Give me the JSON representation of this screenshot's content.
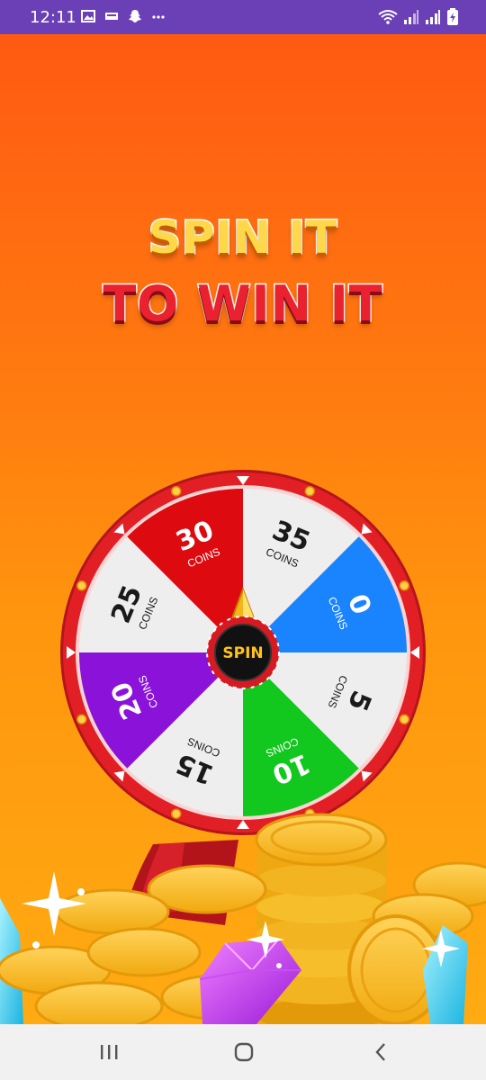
{
  "status_bar": {
    "time": "12:11",
    "left_icons": [
      "image-icon",
      "message-icon",
      "snapchat-icon",
      "more-icon"
    ],
    "right_icons": [
      "wifi-icon",
      "signal-icon",
      "signal-icon",
      "battery-icon"
    ],
    "background": "#6b3fb5"
  },
  "title": {
    "line1": "SPIN IT",
    "line2": "TO WIN IT",
    "line1_color": "#ffd84a",
    "line2_color": "#ea2230"
  },
  "wheel": {
    "rim_color": "#e31f26",
    "spin_label": "SPIN",
    "segments": [
      {
        "value": "35",
        "unit": "COINS",
        "color": "#eeeeee",
        "text_color": "#1a1a1a"
      },
      {
        "value": "0",
        "unit": "COINS",
        "color": "#1a84ff",
        "text_color": "#ffffff"
      },
      {
        "value": "5",
        "unit": "COINS",
        "color": "#eeeeee",
        "text_color": "#1a1a1a"
      },
      {
        "value": "10",
        "unit": "COINS",
        "color": "#12c81e",
        "text_color": "#ffffff"
      },
      {
        "value": "15",
        "unit": "COINS",
        "color": "#eeeeee",
        "text_color": "#1a1a1a"
      },
      {
        "value": "20",
        "unit": "COINS",
        "color": "#8a12d9",
        "text_color": "#ffffff"
      },
      {
        "value": "25",
        "unit": "COINS",
        "color": "#eeeeee",
        "text_color": "#1a1a1a"
      },
      {
        "value": "30",
        "unit": "COINS",
        "color": "#dd0a10",
        "text_color": "#ffffff"
      }
    ]
  },
  "nav_bar": {
    "recents_icon": "recents-icon",
    "home_icon": "home-icon",
    "back_icon": "back-icon"
  }
}
